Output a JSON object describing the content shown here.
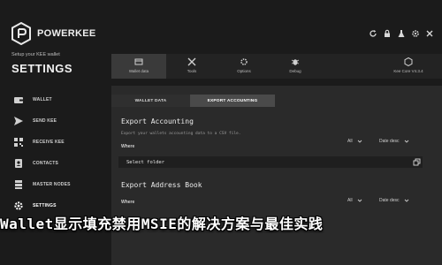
{
  "app": {
    "brand": "POWERKEE",
    "subtitle": "Setup your KEE wallet",
    "title": "SETTINGS"
  },
  "sidebar": {
    "items": [
      {
        "label": "WALLET",
        "icon": "wallet-icon"
      },
      {
        "label": "SEND KEE",
        "icon": "send-icon"
      },
      {
        "label": "RECEIVE KEE",
        "icon": "receive-icon"
      },
      {
        "label": "CONTACTS",
        "icon": "contacts-icon"
      },
      {
        "label": "MASTER NODES",
        "icon": "master-nodes-icon"
      },
      {
        "label": "SETTINGS",
        "icon": "gear-icon"
      }
    ]
  },
  "window_controls": [
    "refresh-icon",
    "lock-icon",
    "flask-icon",
    "settings-icon",
    "close-icon"
  ],
  "toolbar": {
    "items": [
      {
        "label": "Wallet data",
        "icon": "wallet-data-icon"
      },
      {
        "label": "Tools",
        "icon": "tools-icon"
      },
      {
        "label": "Options",
        "icon": "options-icon"
      },
      {
        "label": "Debug",
        "icon": "debug-icon"
      },
      {
        "label": "Kee Core V4.3.4",
        "icon": "kee-core-icon"
      }
    ]
  },
  "tabs": [
    "WALLET DATA",
    "EXPORT ACCOUNTING"
  ],
  "export_accounting": {
    "title": "Export Accounting",
    "description": "Export your wallets accounting data to a CSV file.",
    "where_label": "Where",
    "filter_all": "All",
    "sort": "Date desc",
    "folder_value": "Select folder"
  },
  "export_address_book": {
    "title": "Export Address Book",
    "where_label": "Where",
    "filter_all": "All",
    "sort": "Date desc"
  },
  "caption": "Wallet显示填充禁用MSIE的解决方案与最佳实践",
  "colors": {
    "background": "#1b1b1b",
    "panel": "#2a2a2a",
    "active_tab": "#4a4a4a",
    "text": "#d8d8d8"
  }
}
